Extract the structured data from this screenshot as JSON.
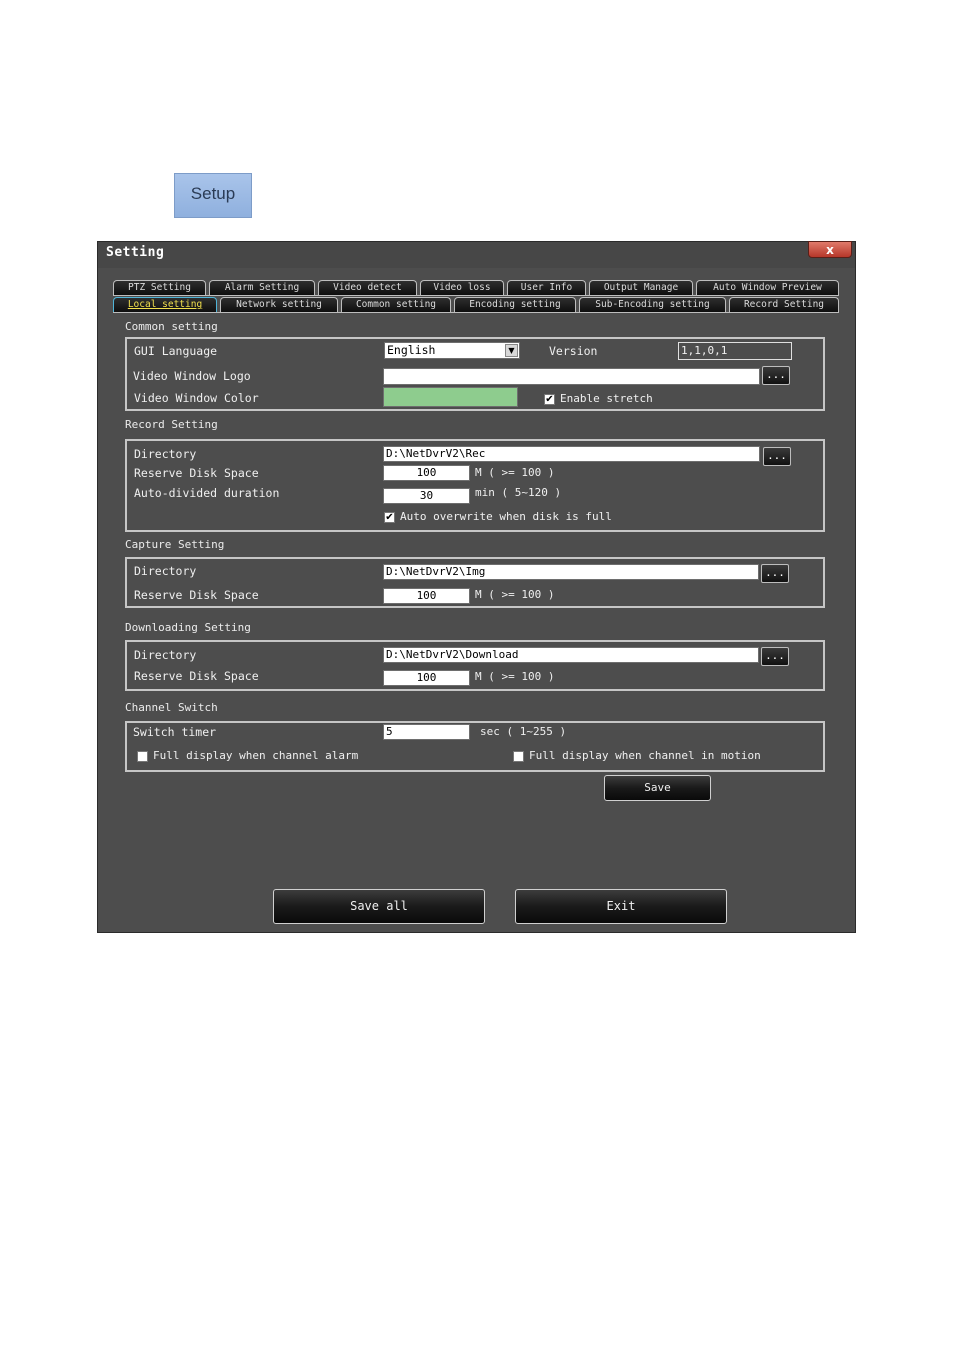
{
  "setup_button": {
    "label": "Setup"
  },
  "window": {
    "title": "Setting",
    "close_label": "x"
  },
  "tabs_row1": [
    "PTZ Setting",
    "Alarm Setting",
    "Video detect",
    "Video loss",
    "User Info",
    "Output Manage",
    "Auto Window Preview"
  ],
  "tabs_row2": [
    "Local setting",
    "Network setting",
    "Common setting",
    "Encoding setting",
    "Sub-Encoding setting",
    "Record Setting"
  ],
  "active_tab": "Local setting",
  "common": {
    "title": "Common setting",
    "gui_language_label": "GUI Language",
    "gui_language_value": "English",
    "version_label": "Version",
    "version_value": "1,1,0,1",
    "logo_label": "Video Window Logo",
    "logo_value": "",
    "color_label": "Video Window Color",
    "color_value": "#8ecc8e",
    "stretch_label": "Enable stretch",
    "stretch_checked": true
  },
  "record": {
    "title": "Record Setting",
    "dir_label": "Directory",
    "dir_value": "D:\\NetDvrV2\\Rec",
    "disk_label": "Reserve Disk Space",
    "disk_value": "100",
    "disk_hint": "M ( >= 100 )",
    "duration_label": "Auto-divided duration",
    "duration_value": "30",
    "duration_hint": "min ( 5~120 )",
    "overwrite_label": "Auto overwrite when disk is full",
    "overwrite_checked": true
  },
  "capture": {
    "title": "Capture Setting",
    "dir_label": "Directory",
    "dir_value": "D:\\NetDvrV2\\Img",
    "disk_label": "Reserve Disk Space",
    "disk_value": "100",
    "disk_hint": "M ( >= 100 )"
  },
  "download": {
    "title": "Downloading Setting",
    "dir_label": "Directory",
    "dir_value": "D:\\NetDvrV2\\Download",
    "disk_label": "Reserve Disk Space",
    "disk_value": "100",
    "disk_hint": "M ( >= 100 )"
  },
  "channel": {
    "title": "Channel Switch",
    "timer_label": "Switch timer",
    "timer_value": "5",
    "timer_hint": "sec ( 1~255 )",
    "alarm_label": "Full display when channel alarm",
    "alarm_checked": false,
    "motion_label": "Full display when channel in motion",
    "motion_checked": false
  },
  "browse_label": "...",
  "buttons": {
    "save": "Save",
    "save_all": "Save all",
    "exit": "Exit"
  }
}
